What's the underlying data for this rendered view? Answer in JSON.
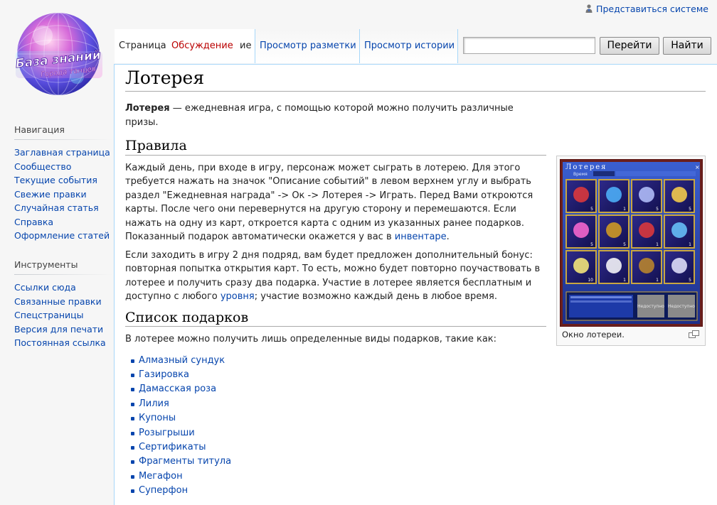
{
  "personal": {
    "login_label": "Представиться системе"
  },
  "logo": {
    "line1": "База знаний",
    "line2": "Города танцев"
  },
  "nav": {
    "heading": "Навигация",
    "items": [
      "Заглавная страница",
      "Сообщество",
      "Текущие события",
      "Свежие правки",
      "Случайная статья",
      "Справка",
      "Оформление статей"
    ]
  },
  "tools": {
    "heading": "Инструменты",
    "items": [
      "Ссылки сюда",
      "Связанные правки",
      "Спецстраницы",
      "Версия для печати",
      "Постоянная ссылка"
    ]
  },
  "tabs": {
    "page": "Страница",
    "talk": "Обсуждение",
    "talk_tail": "ие",
    "view_source": "Просмотр разметки",
    "history": "Просмотр истории"
  },
  "search": {
    "value": "",
    "go": "Перейти",
    "find": "Найти"
  },
  "article": {
    "title": "Лотерея",
    "intro_bold": "Лотерея",
    "intro_rest": " — ежедневная игра, с помощью которой можно получить различные призы.",
    "rules_heading": "Правила",
    "rules_p1": "Каждый день, при входе в игру, персонаж может сыграть в лотерею. Для этого требуется нажать на значок \"Описание событий\" в левом верхнем углу и выбрать раздел \"Ежедневная награда\" -> Ок -> Лотерея -> Играть. Перед Вами откроются карты. После чего они перевернутся на другую сторону и перемешаются. Если нажать на одну из карт, откроется карта с одним из указанных ранее подарков. Показанный подарок автоматически окажется у вас в ",
    "rules_p1_link": "инвентаре",
    "rules_p1_end": ".",
    "rules_p2": "Если заходить в игру 2 дня подряд, вам будет предложен дополнительный бонус: повторная попытка открытия карт. То есть, можно будет повторно поучаствовать в лотерее и получить сразу два подарка. Участие в лотерее является бесплатным и доступно с любого ",
    "rules_p2_link": "уровня",
    "rules_p2_end": "; участие возможно каждый день в любое время.",
    "prizes_heading": "Список подарков",
    "prizes_intro": "В лотерее можно получить лишь определенные виды подарков, такие как:",
    "prizes": [
      "Алмазный сундук",
      "Газировка",
      "Дамасская роза",
      "Лилия",
      "Купоны",
      "Розыгрыши",
      "Сертификаты",
      "Фрагменты титула",
      "Мегафон",
      "Суперфон"
    ]
  },
  "thumb": {
    "game_title": "Лотерея",
    "time_label": "Время",
    "counts": [
      "5",
      "1",
      "5",
      "5",
      "5",
      "5",
      "1",
      "1",
      "10",
      "1",
      "1",
      "5"
    ],
    "button1": "Недоступно",
    "button2": "Недоступно",
    "caption": "Окно лотереи."
  }
}
